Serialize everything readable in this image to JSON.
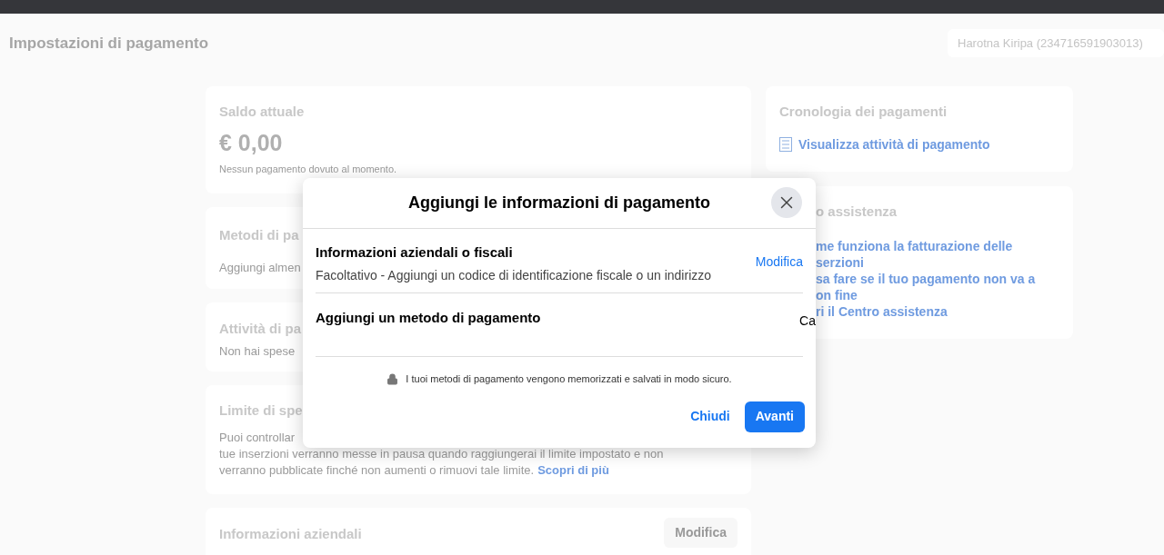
{
  "header": {
    "title": "Impostazioni di pagamento",
    "account": "Harotna Kiripa (234716591903013)"
  },
  "balance_card": {
    "title": "Saldo attuale",
    "amount": "€ 0,00",
    "note": "Nessun pagamento dovuto al momento."
  },
  "methods_card": {
    "title": "Metodi di pa",
    "text": "Aggiungi almen"
  },
  "activity_card": {
    "title": "Attività di pa",
    "text": "Non hai spese"
  },
  "limit_card": {
    "title": "Limite di spe",
    "lines": [
      "Puoi controllar",
      "tue inserzioni verranno messe in pausa quando raggiungerai il limite impostato e non",
      "verranno pubblicate finché non aumenti o rimuovi tale limite."
    ],
    "link": "Scopri di più"
  },
  "business_card": {
    "title": "Informazioni aziendali",
    "button": "Modifica"
  },
  "history_card": {
    "title": "Cronologia dei pagamenti",
    "link": "Visualizza attività di pagamento"
  },
  "help_card": {
    "title": "o assistenza",
    "links": [
      [
        "me funziona la fatturazione delle",
        "serzioni"
      ],
      [
        "sa fare se il tuo pagamento non va a",
        "on fine"
      ],
      [
        "ri il Centro assistenza"
      ]
    ]
  },
  "dialog": {
    "title": "Aggiungi le informazioni di pagamento",
    "sections": [
      {
        "title": "Informazioni aziendali o fiscali",
        "subtitle": "Facoltativo - Aggiungi un codice di identificazione fiscale o un indirizzo",
        "action": "Modifica",
        "kind": "link"
      },
      {
        "title": "Aggiungi un metodo di pagamento",
        "action": "Ca",
        "kind": "cut"
      }
    ],
    "note": "I tuoi metodi di pagamento vengono memorizzati e salvati in modo sicuro.",
    "buttons": [
      {
        "label": "Chiudi",
        "kind": "secondary"
      },
      {
        "label": "Avanti",
        "kind": "primary"
      }
    ]
  }
}
